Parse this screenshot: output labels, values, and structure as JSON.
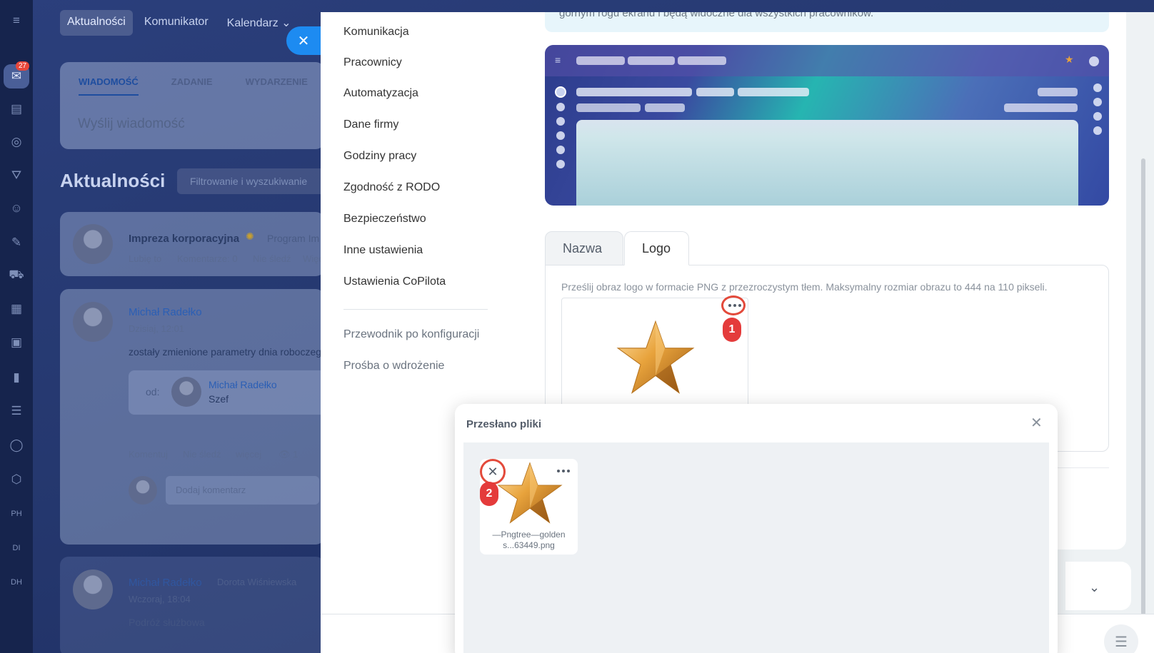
{
  "background": {
    "notification_count": "27",
    "top_nav": [
      "Aktualności",
      "Komunikator",
      "Kalendarz ⌄"
    ],
    "compose_tabs": [
      "WIADOMOŚĆ",
      "ZADANIE",
      "WYDARZENIE"
    ],
    "compose_placeholder": "Wyślij wiadomość",
    "feed_title": "Aktualności",
    "feed_filter_placeholder": "Filtrowanie i wyszukiwanie",
    "post1": {
      "title": "Impreza korporacyjna",
      "title_suffix": "Program Im",
      "actions": [
        "Lubię to",
        "Komentarze: 0",
        "Nie śledź",
        "Więc"
      ]
    },
    "post2": {
      "author": "Michał Radełko",
      "time": "Dzisiaj, 12:01",
      "text": "zostały zmienione parametry dnia roboczego",
      "from_label": "od:",
      "from_name": "Michał Radełko",
      "from_role": "Szef",
      "actions": [
        "Komentuj",
        "Nie śledź",
        "więcej",
        "👁 1"
      ],
      "comment_placeholder": "Dodaj komentarz"
    },
    "post3": {
      "author": "Michał Radełko",
      "recipient": "Dorota Wiśniewska",
      "time": "Wczoraj, 18:04",
      "title": "Podróż służbowa"
    },
    "rail_icons": [
      "chat-icon",
      "news-icon",
      "target-icon",
      "funnel-icon",
      "robot-icon",
      "pen-icon",
      "cart-icon",
      "shop-icon",
      "calendar-icon",
      "chart-icon",
      "doc-icon",
      "circle-icon",
      "box-icon",
      "PH",
      "DI",
      "DH"
    ]
  },
  "settings_menu": {
    "items": [
      "Komunikacja",
      "Pracownicy",
      "Automatyzacja",
      "Dane firmy",
      "Godziny pracy",
      "Zgodność z RODO",
      "Bezpieczeństwo",
      "Inne ustawienia",
      "Ustawienia CoPilota"
    ],
    "secondary": [
      "Przewodnik po konfiguracji",
      "Prośba o wdrożenie"
    ]
  },
  "content": {
    "info_text": "górnym rogu ekranu i będą widoczne dla wszystkich pracowników.",
    "tabs": [
      "Nazwa",
      "Logo"
    ],
    "active_tab": "Logo",
    "logo_hint": "Prześlij obraz logo w formacie PNG z przezroczystym tłem. Maksymalny rozmiar obrazu to 444 na 110 pikseli.",
    "step1_label": "1"
  },
  "upload_popup": {
    "title": "Przesłano pliki",
    "file_name_line1": "—Pngtree—golden",
    "file_name_line2": "s...63449.png",
    "step2_label": "2"
  },
  "colors": {
    "accent_blue": "#1d8bf1",
    "highlight_red": "#e34a3b",
    "star_gold": "#e8a33c"
  }
}
